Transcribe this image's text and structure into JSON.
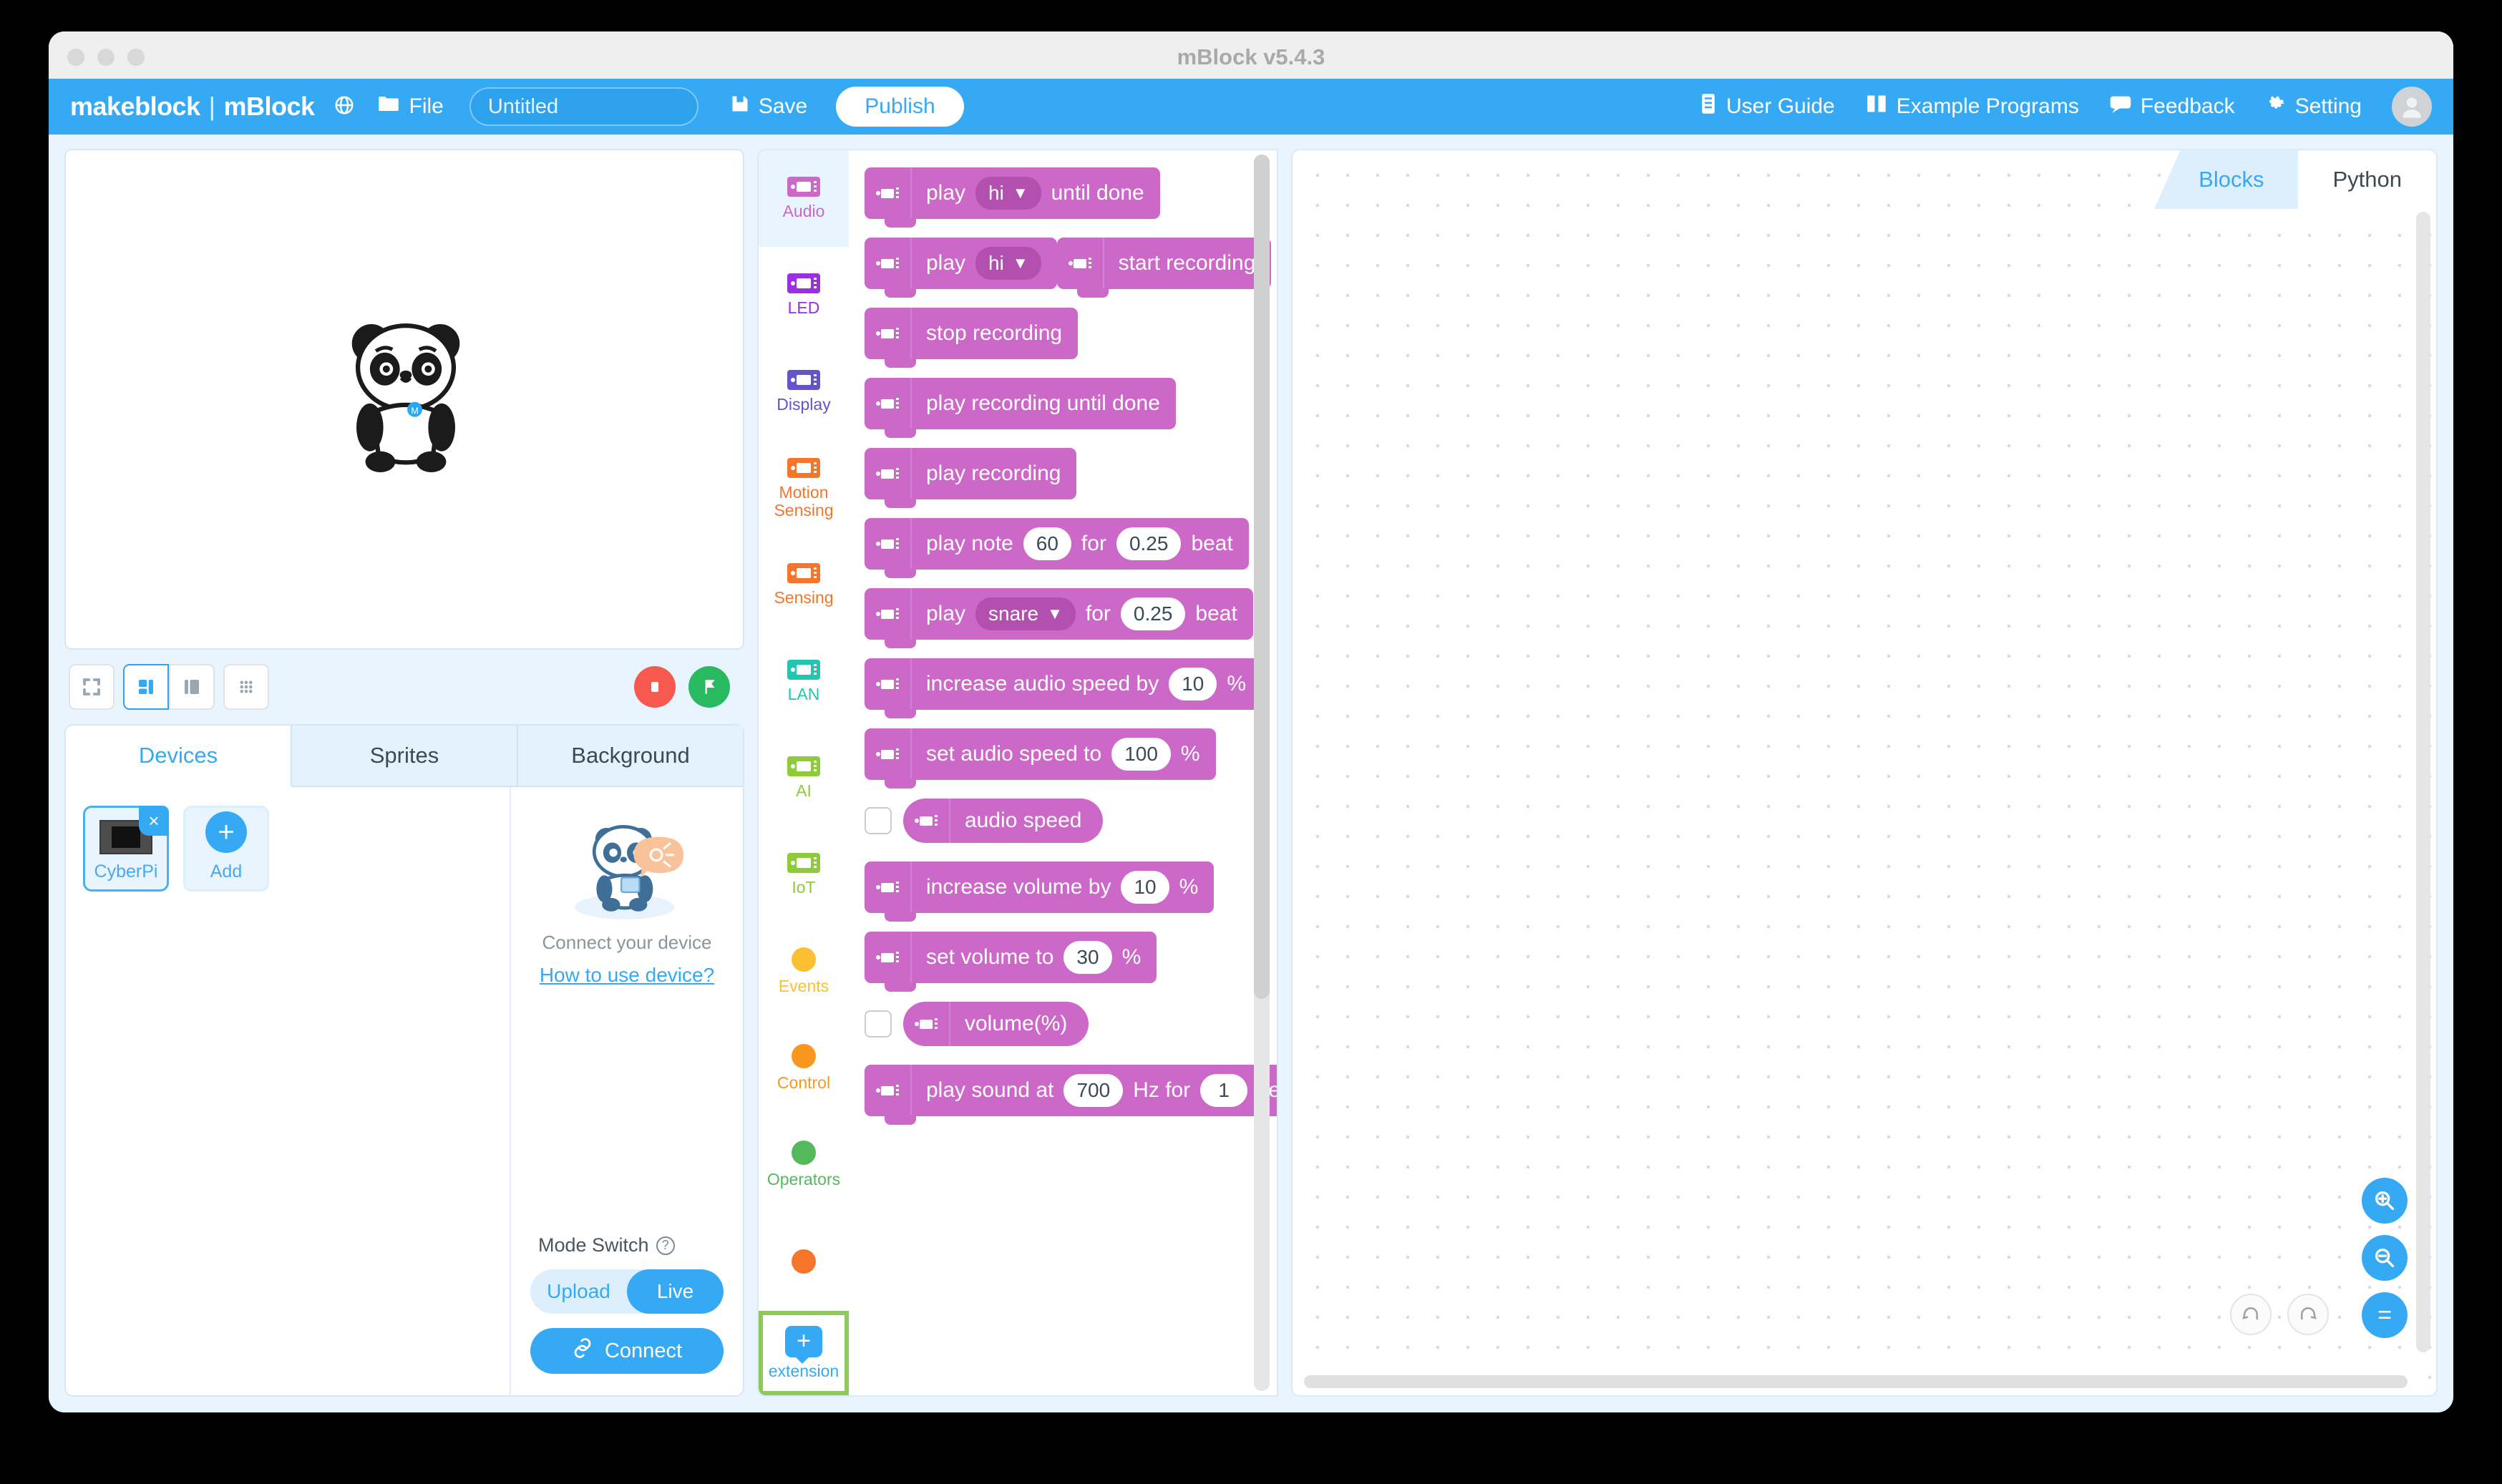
{
  "window": {
    "title": "mBlock v5.4.3"
  },
  "toolbar": {
    "logo_make": "makeblock",
    "logo_sep": "|",
    "logo_mblock": "mBlock",
    "globe_icon": "globe-icon",
    "file_label": "File",
    "project_name_value": "Untitled",
    "project_name_placeholder": "Untitled",
    "save_label": "Save",
    "publish_label": "Publish",
    "user_guide_label": "User Guide",
    "example_programs_label": "Example Programs",
    "feedback_label": "Feedback",
    "setting_label": "Setting",
    "accent_color": "#36a9f5"
  },
  "stage": {
    "sprite_name": "panda-sprite",
    "layout_buttons": [
      "fullscreen-layout",
      "split-layout",
      "wide-layout",
      "grid-layout"
    ],
    "active_layout": "split-layout",
    "stop_button": "stop-button",
    "go_button": "green-flag-button",
    "stop_color": "#f8594f",
    "go_color": "#29ba61"
  },
  "device_panel": {
    "tabs": [
      {
        "label": "Devices",
        "active": true
      },
      {
        "label": "Sprites",
        "active": false
      },
      {
        "label": "Background",
        "active": false
      }
    ],
    "devices": [
      {
        "label": "CyberPi",
        "selected": true,
        "close": "×"
      },
      {
        "label": "Add",
        "selected": false,
        "plus": "+"
      }
    ],
    "connect_hint": "Connect your device",
    "how_to_link": "How to use device?",
    "mode_switch_label": "Mode Switch",
    "mode_help_icon": "?",
    "mode_options": [
      {
        "label": "Upload",
        "active": false
      },
      {
        "label": "Live",
        "active": true
      }
    ],
    "connect_button": "Connect"
  },
  "categories": [
    {
      "label": "Audio",
      "color": "#cc68c7",
      "shape": "chip",
      "selected": true
    },
    {
      "label": "LED",
      "color": "#9a2ee0",
      "shape": "chip",
      "selected": false
    },
    {
      "label": "Display",
      "color": "#6355c9",
      "shape": "chip",
      "selected": false
    },
    {
      "label": "Motion\nSensing",
      "color": "#f5752a",
      "shape": "chip",
      "selected": false
    },
    {
      "label": "Sensing",
      "color": "#f5752a",
      "shape": "chip",
      "selected": false
    },
    {
      "label": "LAN",
      "color": "#23c4b0",
      "shape": "chip",
      "selected": false
    },
    {
      "label": "AI",
      "color": "#8ecb3a",
      "shape": "chip",
      "selected": false
    },
    {
      "label": "IoT",
      "color": "#8ecb3a",
      "shape": "chip",
      "selected": false
    },
    {
      "label": "Events",
      "color": "#fbbf31",
      "shape": "round",
      "selected": false
    },
    {
      "label": "Control",
      "color": "#f8971d",
      "shape": "round",
      "selected": false
    },
    {
      "label": "Operators",
      "color": "#54b95a",
      "shape": "round",
      "selected": false
    },
    {
      "label": "",
      "color": "#f5752a",
      "shape": "round",
      "selected": false
    }
  ],
  "extension": {
    "label": "extension",
    "icon": "add-extension-icon",
    "highlight_color": "#8fc95b"
  },
  "palette": {
    "category_color": "#cc68c7",
    "blocks": [
      {
        "type": "stack",
        "parts": [
          {
            "t": "text",
            "v": "play"
          },
          {
            "t": "dropdown",
            "v": "hi"
          },
          {
            "t": "text",
            "v": "until done"
          }
        ]
      },
      {
        "type": "stack",
        "parts": [
          {
            "t": "text",
            "v": "play"
          },
          {
            "t": "dropdown",
            "v": "hi"
          }
        ]
      },
      {
        "type": "stack",
        "parts": [
          {
            "t": "text",
            "v": "start recording"
          }
        ]
      },
      {
        "type": "stack",
        "parts": [
          {
            "t": "text",
            "v": "stop recording"
          }
        ]
      },
      {
        "type": "stack",
        "parts": [
          {
            "t": "text",
            "v": "play recording until done"
          }
        ]
      },
      {
        "type": "stack",
        "parts": [
          {
            "t": "text",
            "v": "play recording"
          }
        ]
      },
      {
        "type": "stack",
        "parts": [
          {
            "t": "text",
            "v": "play note"
          },
          {
            "t": "num",
            "v": "60"
          },
          {
            "t": "text",
            "v": "for"
          },
          {
            "t": "num",
            "v": "0.25"
          },
          {
            "t": "text",
            "v": "beat"
          }
        ]
      },
      {
        "type": "stack",
        "parts": [
          {
            "t": "text",
            "v": "play"
          },
          {
            "t": "dropdown",
            "v": "snare"
          },
          {
            "t": "text",
            "v": "for"
          },
          {
            "t": "num",
            "v": "0.25"
          },
          {
            "t": "text",
            "v": "beat"
          }
        ]
      },
      {
        "type": "stack",
        "parts": [
          {
            "t": "text",
            "v": "increase audio speed by"
          },
          {
            "t": "num",
            "v": "10"
          },
          {
            "t": "text",
            "v": "%"
          }
        ]
      },
      {
        "type": "stack",
        "parts": [
          {
            "t": "text",
            "v": "set audio speed to"
          },
          {
            "t": "num",
            "v": "100"
          },
          {
            "t": "text",
            "v": "%"
          }
        ]
      },
      {
        "type": "reporter",
        "checkbox": false,
        "parts": [
          {
            "t": "text",
            "v": "audio speed"
          }
        ]
      },
      {
        "type": "stack",
        "parts": [
          {
            "t": "text",
            "v": "increase volume by"
          },
          {
            "t": "num",
            "v": "10"
          },
          {
            "t": "text",
            "v": "%"
          }
        ]
      },
      {
        "type": "stack",
        "parts": [
          {
            "t": "text",
            "v": "set volume to"
          },
          {
            "t": "num",
            "v": "30"
          },
          {
            "t": "text",
            "v": "%"
          }
        ]
      },
      {
        "type": "reporter",
        "checkbox": false,
        "parts": [
          {
            "t": "text",
            "v": "volume(%)"
          }
        ]
      },
      {
        "type": "stack",
        "parts": [
          {
            "t": "text",
            "v": "play sound at"
          },
          {
            "t": "num",
            "v": "700"
          },
          {
            "t": "text",
            "v": "Hz for"
          },
          {
            "t": "num",
            "v": "1"
          },
          {
            "t": "text",
            "v": "sec"
          }
        ]
      }
    ]
  },
  "code_area": {
    "tabs": [
      {
        "label": "Blocks",
        "active": true
      },
      {
        "label": "Python",
        "active": false
      }
    ],
    "zoom_in_icon": "zoom-in-icon",
    "zoom_out_icon": "zoom-out-icon",
    "zoom_reset_icon": "=",
    "undo_icon": "undo-icon",
    "redo_icon": "redo-icon"
  }
}
